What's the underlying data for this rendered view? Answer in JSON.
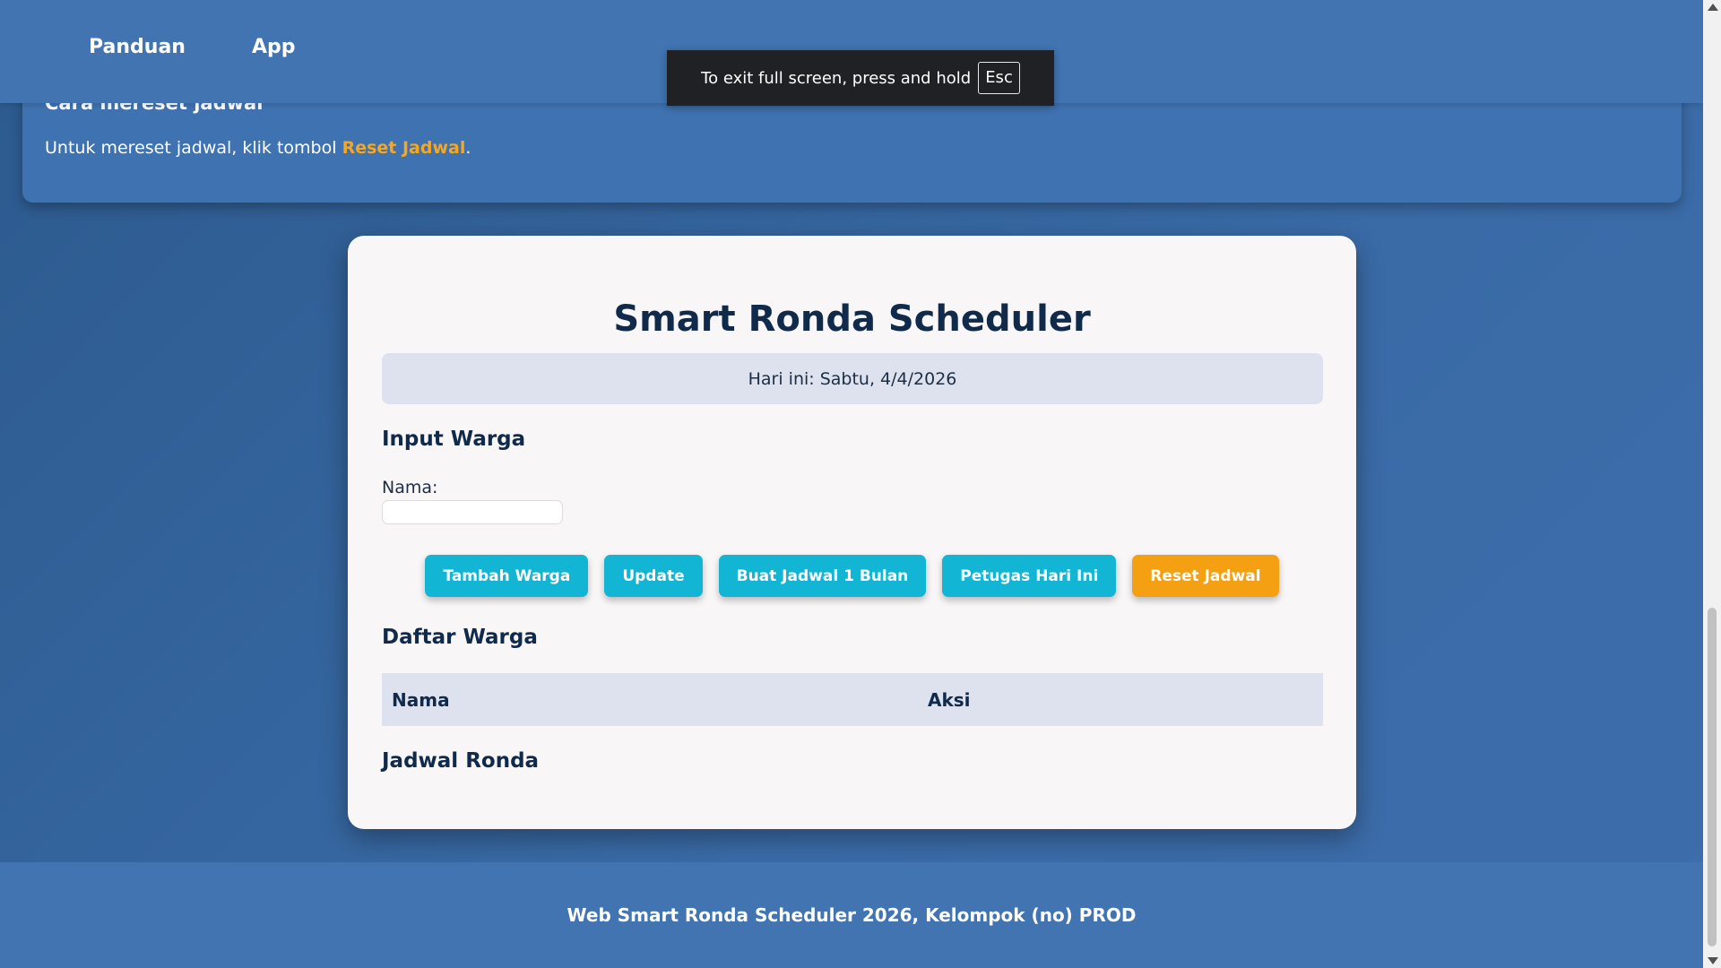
{
  "nav": {
    "items": [
      {
        "label": "Panduan"
      },
      {
        "label": "App"
      }
    ]
  },
  "guide": {
    "heading": "Cara mereset jadwal",
    "text_before": "Untuk mereset jadwal, klik tombol ",
    "highlight": "Reset Jadwal",
    "text_after": "."
  },
  "fullscreen_toast": {
    "text": "To exit full screen, press and hold",
    "key": "Esc"
  },
  "app": {
    "title": "Smart Ronda Scheduler",
    "date_text": "Hari ini: Sabtu, 4/4/2026",
    "input_section_title": "Input Warga",
    "name_label": "Nama:",
    "name_value": "",
    "buttons": {
      "add": "Tambah Warga",
      "update": "Update",
      "generate": "Buat Jadwal 1 Bulan",
      "today": "Petugas Hari Ini",
      "reset": "Reset Jadwal"
    },
    "list_section_title": "Daftar Warga",
    "table_headers": [
      "Nama",
      "Aksi"
    ],
    "table_rows": [],
    "schedule_section_title": "Jadwal Ronda"
  },
  "footer": {
    "text": "Web Smart Ronda Scheduler 2026, Kelompok (no) PROD"
  },
  "colors": {
    "primary_button": "#12b5d4",
    "reset_button": "#f5a012",
    "navbar": "#4174b1",
    "card": "#f8f6f7"
  }
}
